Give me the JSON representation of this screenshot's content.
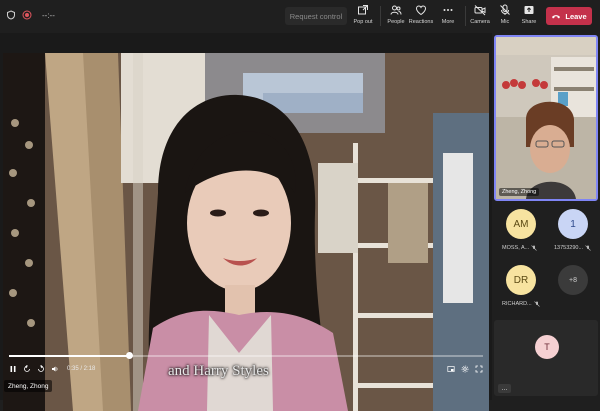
{
  "toolbar": {
    "timer": "--:--",
    "request_control": "Request control",
    "pop_out": "Pop out",
    "people": "People",
    "reactions": "Reactions",
    "more": "More",
    "camera": "Camera",
    "mic": "Mic",
    "share": "Share",
    "leave": "Leave"
  },
  "stage": {
    "caption": "and Harry Styles",
    "timecode": "0:35 / 2:18",
    "progress": 0.254,
    "presenter_name": "Zheng, Zhong"
  },
  "panel": {
    "self_name": "Zheng, Zhong",
    "participants": [
      {
        "initials": "AM",
        "name": "MOSS, A...",
        "color": "#f7e3a0",
        "text_color": "#5b4a14"
      },
      {
        "initials": "1",
        "name": "13753290...",
        "color": "#c9d5f5",
        "text_color": "#2f4a8c"
      },
      {
        "initials": "DR",
        "name": "RICHARD...",
        "color": "#f7e3a0",
        "text_color": "#5b4a14"
      }
    ],
    "more_count": "+8",
    "bottom_tile_initial": "T",
    "more_options": "..."
  },
  "colors": {
    "leave": "#c4314b",
    "active_border": "#7f85f5",
    "background": "#1f1f1f"
  }
}
